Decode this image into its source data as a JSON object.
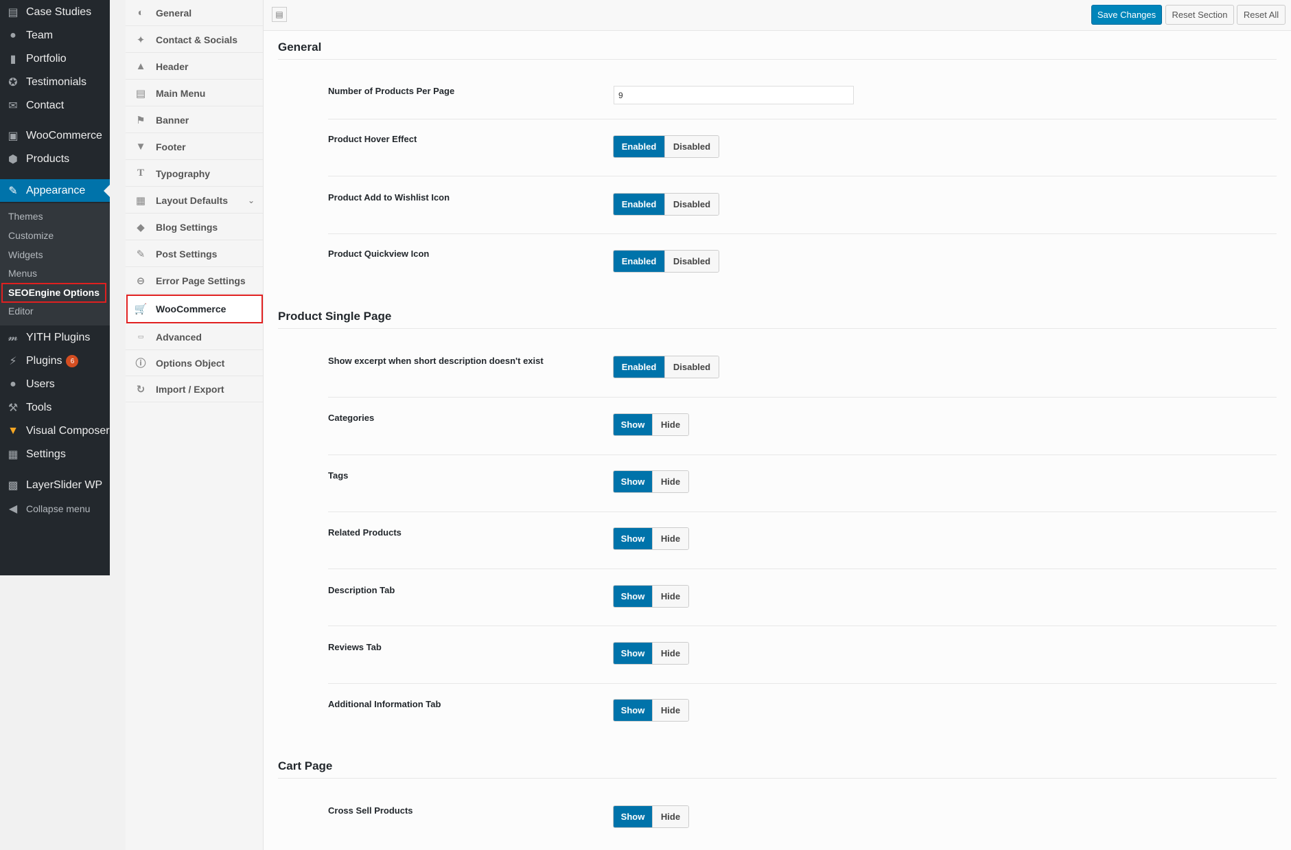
{
  "wp_menu": {
    "items": [
      {
        "label": "Case Studies",
        "icon": "book-icon"
      },
      {
        "label": "Team",
        "icon": "user-icon"
      },
      {
        "label": "Portfolio",
        "icon": "folder-icon"
      },
      {
        "label": "Testimonials",
        "icon": "award-icon"
      },
      {
        "label": "Contact",
        "icon": "envelope-icon"
      },
      {
        "label": "WooCommerce",
        "icon": "woo-icon"
      },
      {
        "label": "Products",
        "icon": "box-icon"
      },
      {
        "label": "Appearance",
        "icon": "brush-icon"
      },
      {
        "label": "YITH Plugins",
        "icon": "yith-icon"
      },
      {
        "label": "Plugins",
        "icon": "plug-icon",
        "badge": "6"
      },
      {
        "label": "Users",
        "icon": "users-icon"
      },
      {
        "label": "Tools",
        "icon": "wrench-icon"
      },
      {
        "label": "Visual Composer",
        "icon": "vc-icon"
      },
      {
        "label": "Settings",
        "icon": "sliders-icon"
      },
      {
        "label": "LayerSlider WP",
        "icon": "layers-icon"
      },
      {
        "label": "Collapse menu",
        "icon": "collapse-icon"
      }
    ],
    "submenu": [
      "Themes",
      "Customize",
      "Widgets",
      "Menus",
      "SEOEngine Options",
      "Editor"
    ]
  },
  "options_nav": {
    "items": [
      {
        "label": "General",
        "icon": "dashboard-icon"
      },
      {
        "label": "Contact & Socials",
        "icon": "twitter-icon"
      },
      {
        "label": "Header",
        "icon": "triangle-up-icon"
      },
      {
        "label": "Main Menu",
        "icon": "book-icon"
      },
      {
        "label": "Banner",
        "icon": "flag-icon"
      },
      {
        "label": "Footer",
        "icon": "triangle-down-icon"
      },
      {
        "label": "Typography",
        "icon": "text-icon"
      },
      {
        "label": "Layout Defaults",
        "icon": "grid-icon"
      },
      {
        "label": "Blog Settings",
        "icon": "tags-icon"
      },
      {
        "label": "Post Settings",
        "icon": "edit-icon"
      },
      {
        "label": "Error Page Settings",
        "icon": "minus-circle-icon"
      },
      {
        "label": "WooCommerce",
        "icon": "cart-icon"
      },
      {
        "label": "Advanced",
        "icon": "css-icon"
      },
      {
        "label": "Options Object",
        "icon": "info-icon"
      },
      {
        "label": "Import / Export",
        "icon": "refresh-icon"
      }
    ]
  },
  "toolbar": {
    "save": "Save Changes",
    "reset_section": "Reset Section",
    "reset_all": "Reset All"
  },
  "sections": {
    "general": {
      "title": "General",
      "products_per_page_label": "Number of Products Per Page",
      "products_per_page_value": "9",
      "hover_label": "Product Hover Effect",
      "wishlist_label": "Product Add to Wishlist Icon",
      "quickview_label": "Product Quickview Icon"
    },
    "single": {
      "title": "Product Single Page",
      "excerpt_label": "Show excerpt when short description doesn't exist",
      "categories_label": "Categories",
      "tags_label": "Tags",
      "related_label": "Related Products",
      "description_label": "Description Tab",
      "reviews_label": "Reviews Tab",
      "additional_label": "Additional Information Tab"
    },
    "cart": {
      "title": "Cart Page",
      "cross_sell_label": "Cross Sell Products"
    }
  },
  "toggle_labels": {
    "enabled": "Enabled",
    "disabled": "Disabled",
    "show": "Show",
    "hide": "Hide"
  },
  "colors": {
    "accent": "#0073aa",
    "admin_bar": "#23282d",
    "highlight_box": "#e02020"
  }
}
